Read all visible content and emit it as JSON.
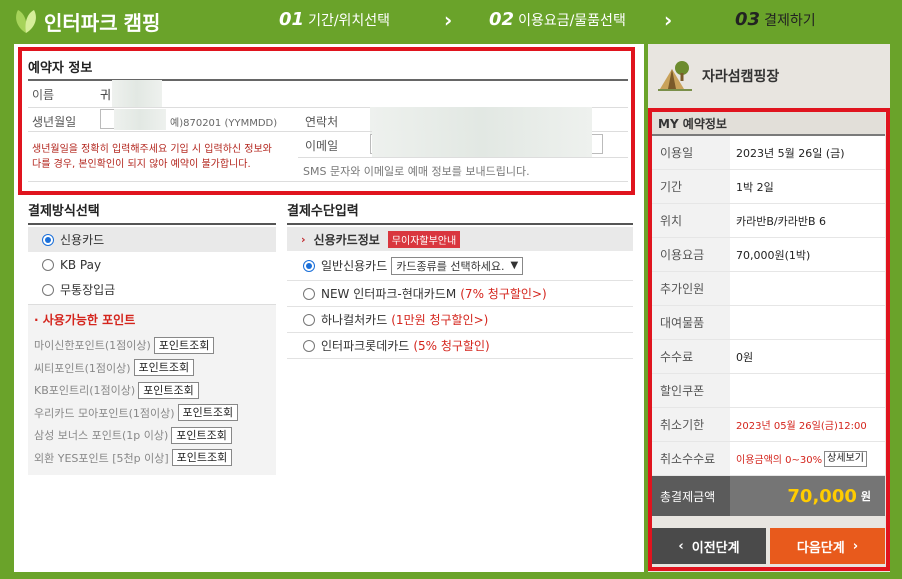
{
  "header": {
    "logo_text": "인터파크",
    "logo_sub": "캠핑",
    "steps": [
      {
        "num": "01",
        "label": "기간/위치선택"
      },
      {
        "num": "02",
        "label": "이용요금/물품선택"
      },
      {
        "num": "03",
        "label": "결제하기"
      }
    ]
  },
  "reservation": {
    "title": "예약자 정보",
    "name_label": "이름",
    "name_value": "귀",
    "birth_label": "생년월일",
    "birth_hint": "예)870201 (YYMMDD)",
    "contact_label": "연락처",
    "email_label": "이메일",
    "warning": "생년월일을 정확히 입력해주세요 기입 시 입력하신 정보와 다를 경우, 본인확인이 되지 않아 예약이 불가합니다.",
    "sms_note": "SMS 문자와 이메일로 예매 정보를 보내드립니다."
  },
  "payment_method": {
    "title": "결제방식선택",
    "options": [
      "신용카드",
      "KB Pay",
      "무통장입금"
    ],
    "selected": 0,
    "points_title": "· 사용가능한 포인트",
    "points": [
      {
        "label": "마이신한포인트(1점이상)",
        "button": "포인트조회"
      },
      {
        "label": "씨티포인트(1점이상)",
        "button": "포인트조회"
      },
      {
        "label": "KB포인트리(1점이상)",
        "button": "포인트조회"
      },
      {
        "label": "우리카드 모아포인트(1점이상)",
        "button": "포인트조회"
      },
      {
        "label": "삼성 보너스 포인트(1p 이상)",
        "button": "포인트조회"
      },
      {
        "label": "외환 YES포인트 [5천p 이상]",
        "button": "포인트조회"
      }
    ]
  },
  "card_input": {
    "title": "결제수단입력",
    "head_label": "신용카드정보",
    "badge": "무이자할부안내",
    "select_placeholder": "카드종류를 선택하세요.",
    "options": [
      {
        "label": "일반신용카드",
        "promo": ""
      },
      {
        "label": "NEW 인터파크-현대카드M",
        "promo": "(7% 청구할인>)"
      },
      {
        "label": "하나컬처카드",
        "promo": "(1만원 청구할인>)"
      },
      {
        "label": "인터파크롯데카드",
        "promo": "(5% 청구할인)"
      }
    ]
  },
  "sidebar": {
    "camp_name": "자라섬캠핑장",
    "my_title": "MY 예약정보",
    "rows": [
      {
        "k": "이용일",
        "v": "2023년 5월 26일 (금)"
      },
      {
        "k": "기간",
        "v": "1박 2일"
      },
      {
        "k": "위치",
        "v": "카라반B/카라반B 6"
      },
      {
        "k": "이용요금",
        "v": "70,000원(1박)"
      },
      {
        "k": "추가인원",
        "v": ""
      },
      {
        "k": "대여물품",
        "v": ""
      },
      {
        "k": "수수료",
        "v": "0원"
      },
      {
        "k": "할인쿠폰",
        "v": ""
      },
      {
        "k": "취소기한",
        "v": "2023년 05월 26일(금)12:00"
      },
      {
        "k": "취소수수료",
        "v": "이용금액의 0~30%"
      }
    ],
    "detail_button": "상세보기",
    "total_label": "총결제금액",
    "total_value": "70,000",
    "total_unit": "원",
    "prev_button": "이전단계",
    "next_button": "다음단계"
  },
  "colors": {
    "brand": "#6aa32a",
    "highlight": "#e0141e",
    "next": "#e85a1c"
  }
}
